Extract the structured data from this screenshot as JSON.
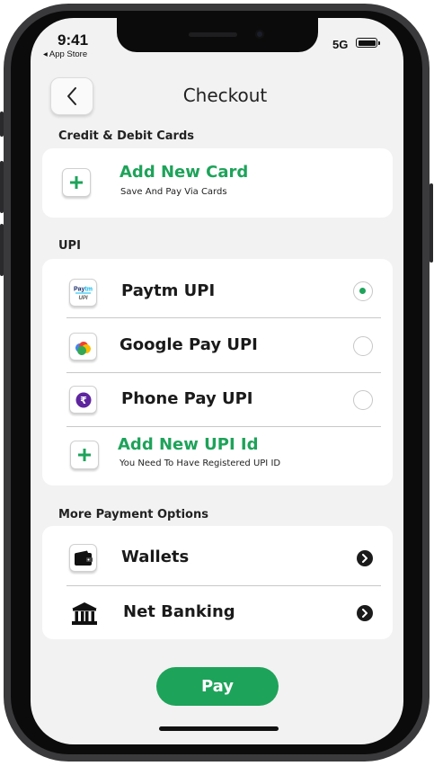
{
  "status_bar": {
    "time": "9:41",
    "back_app": "◂ App Store",
    "network": "5G"
  },
  "header": {
    "title": "Checkout"
  },
  "cards_section": {
    "label": "Credit & Debit Cards",
    "add_card": {
      "title": "Add New Card",
      "subtitle": "Save And Pay Via Cards"
    }
  },
  "upi_section": {
    "label": "UPI",
    "options": [
      {
        "label": "Paytm UPI",
        "selected": true
      },
      {
        "label": "Google Pay UPI",
        "selected": false
      },
      {
        "label": "Phone Pay UPI",
        "selected": false
      }
    ],
    "add_upi": {
      "title": "Add New UPI Id",
      "subtitle": "You Need To Have Registered UPI ID"
    }
  },
  "more_section": {
    "label": "More Payment Options",
    "items": [
      {
        "label": "Wallets"
      },
      {
        "label": "Net Banking"
      }
    ]
  },
  "pay_button": {
    "label": "Pay"
  },
  "colors": {
    "accent": "#1ea35a",
    "background": "#f2f2f2",
    "card": "#ffffff"
  },
  "icons": [
    "chevron-left-icon",
    "plus-icon",
    "paytm-icon",
    "google-pay-icon",
    "phonepe-icon",
    "wallet-icon",
    "bank-icon",
    "chevron-right-icon"
  ]
}
